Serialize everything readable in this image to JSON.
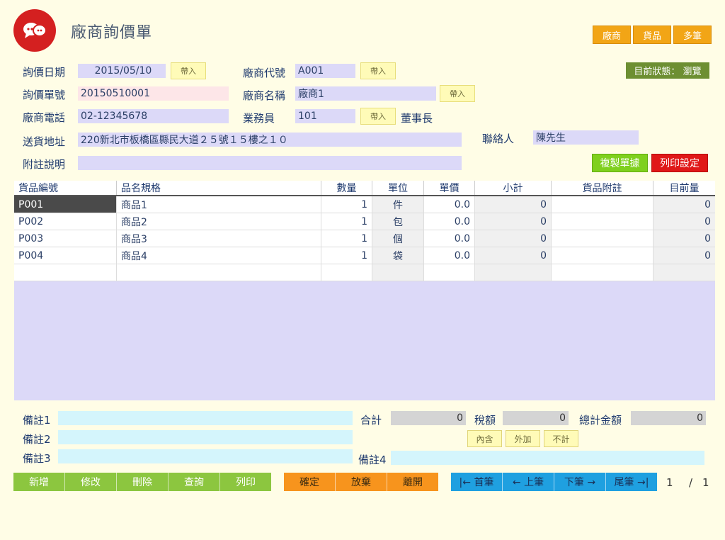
{
  "app": {
    "title": "廠商詢價單"
  },
  "top_buttons": {
    "vendor": "廠商",
    "goods": "貨品",
    "multi": "多筆"
  },
  "status": {
    "text": "目前狀態： 瀏覽"
  },
  "form": {
    "inquiry_date_label": "詢價日期",
    "inquiry_date": "2015/05/10",
    "inquiry_no_label": "詢價單號",
    "inquiry_no": "20150510001",
    "vendor_phone_label": "廠商電話",
    "vendor_phone": "02-12345678",
    "address_label": "送貨地址",
    "address": "220新北市板橋區縣民大道２５號１５樓之１０",
    "note_label": "附註說明",
    "note": "",
    "vendor_code_label": "廠商代號",
    "vendor_code": "A001",
    "vendor_name_label": "廠商名稱",
    "vendor_name": "廠商1",
    "salesperson_label": "業務員",
    "salesperson": "101",
    "salesperson_title": "董事長",
    "contact_label": "聯絡人",
    "contact": "陳先生",
    "import_label": "帶入"
  },
  "actions": {
    "copy": "複製單據",
    "print_settings": "列印設定"
  },
  "table": {
    "headers": [
      "貨品編號",
      "品名規格",
      "數量",
      "單位",
      "單價",
      "小計",
      "貨品附註",
      "目前量"
    ],
    "rows": [
      {
        "code": "P001",
        "name": "商品1",
        "qty": "1",
        "unit": "件",
        "price": "0.0",
        "subtotal": "0",
        "note": "",
        "stock": "0"
      },
      {
        "code": "P002",
        "name": "商品2",
        "qty": "1",
        "unit": "包",
        "price": "0.0",
        "subtotal": "0",
        "note": "",
        "stock": "0"
      },
      {
        "code": "P003",
        "name": "商品3",
        "qty": "1",
        "unit": "個",
        "price": "0.0",
        "subtotal": "0",
        "note": "",
        "stock": "0"
      },
      {
        "code": "P004",
        "name": "商品4",
        "qty": "1",
        "unit": "袋",
        "price": "0.0",
        "subtotal": "0",
        "note": "",
        "stock": "0"
      }
    ]
  },
  "footer": {
    "remark1_label": "備註1",
    "remark2_label": "備註2",
    "remark3_label": "備註3",
    "remark4_label": "備註4",
    "total_label": "合計",
    "total": "0",
    "tax_label": "稅額",
    "tax": "0",
    "grand_total_label": "總計金額",
    "grand_total": "0",
    "tax_included": "內含",
    "tax_excluded": "外加",
    "tax_none": "不計"
  },
  "bottom_bar": {
    "add": "新增",
    "edit": "修改",
    "delete": "刪除",
    "query": "查詢",
    "print": "列印",
    "confirm": "確定",
    "discard": "放棄",
    "leave": "離開",
    "first": "|← 首筆",
    "prev": "← 上筆",
    "next": "下筆 →",
    "last": "尾筆 →|",
    "page_current": "1",
    "page_sep": "/",
    "page_total": "1"
  },
  "colors": {
    "brand": "#d42020",
    "background": "#fffde6",
    "field": "#dcd9f8"
  }
}
